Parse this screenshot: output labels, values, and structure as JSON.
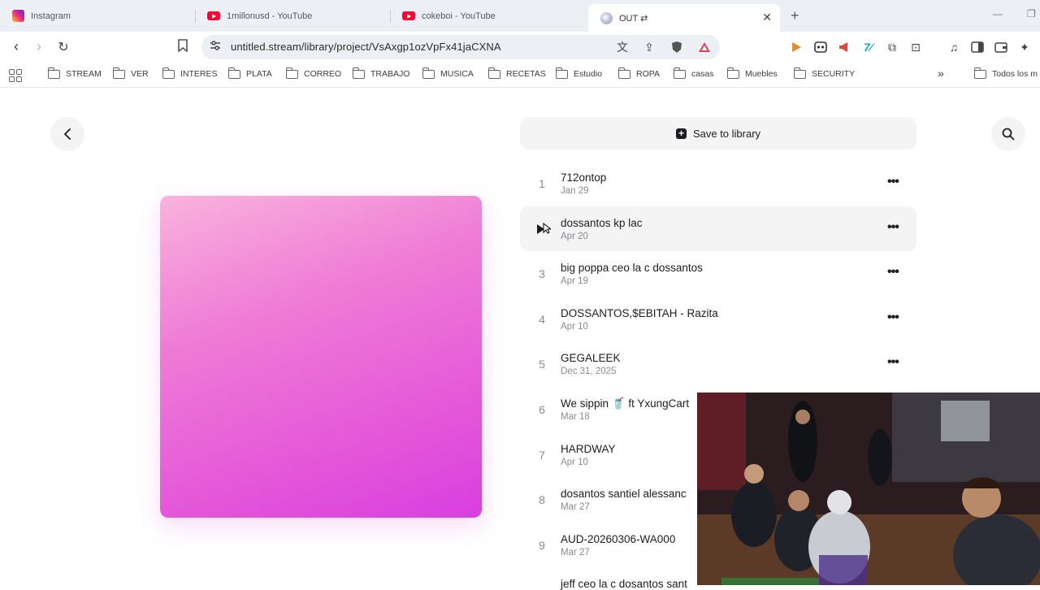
{
  "browser": {
    "tabs": [
      {
        "title": "Instagram",
        "icon": "instagram-icon"
      },
      {
        "title": "1millonusd - YouTube",
        "icon": "youtube-icon"
      },
      {
        "title": "cokeboi - YouTube",
        "icon": "youtube-icon"
      },
      {
        "title": "OUT ⇄",
        "icon": "untitled-stream-icon",
        "active": true
      }
    ],
    "url": "untitled.stream/library/project/VsAxgp1ozVpFx41jaCXNA",
    "bookmarks": [
      "STREAM",
      "VER",
      "INTERES",
      "PLATA",
      "CORREO",
      "TRABAJO",
      "MUSICA",
      "RECETAS",
      "Estudio",
      "ROPA",
      "casas",
      "Muebles",
      "SECURITY"
    ],
    "all_bookmarks_label": "Todos los m"
  },
  "page": {
    "save_label": "Save to library",
    "cover_colors": [
      "#f9b3dd",
      "#e455d9",
      "#d93ee0"
    ],
    "tracks": [
      {
        "num": "1",
        "title": "712ontop",
        "date": "Jan 29"
      },
      {
        "num": "2",
        "title": "dossantos kp lac",
        "date": "Apr 20"
      },
      {
        "num": "3",
        "title": "big poppa ceo la c dossantos",
        "date": "Apr 19"
      },
      {
        "num": "4",
        "title": "DOSSANTOS,$EBITAH - Razita",
        "date": "Apr 10"
      },
      {
        "num": "5",
        "title": "GEGALEEK",
        "date": "Dec 31, 2025"
      },
      {
        "num": "6",
        "title": "We sippin 🥤 ft YxungCart",
        "date": "Mar 18"
      },
      {
        "num": "7",
        "title": "HARDWAY",
        "date": "Apr 10"
      },
      {
        "num": "8",
        "title": "dosantos santiel alessanc",
        "date": "Mar 27"
      },
      {
        "num": "9",
        "title": "AUD-20260306-WA000",
        "date": "Mar 27"
      },
      {
        "num": "",
        "title": "jeff ceo la c dosantos sant",
        "date": ""
      }
    ]
  }
}
